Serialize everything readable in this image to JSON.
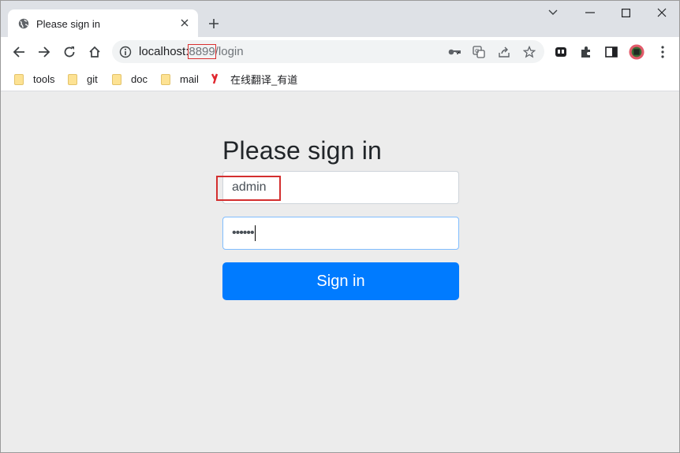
{
  "browser": {
    "tab": {
      "title": "Please sign in",
      "close_icon": "close-icon"
    },
    "new_tab_label": "+",
    "url": {
      "host": "localhost:",
      "port": "8899",
      "path": "/login"
    },
    "bookmarks": [
      {
        "label": "tools",
        "icon": "folder-icon"
      },
      {
        "label": "git",
        "icon": "folder-icon"
      },
      {
        "label": "doc",
        "icon": "folder-icon"
      },
      {
        "label": "mail",
        "icon": "folder-icon"
      },
      {
        "label": "在线翻译_有道",
        "icon": "youdao-icon"
      }
    ],
    "colors": {
      "tabstrip": "#dee1e6",
      "highlight": "#d32f2f"
    }
  },
  "page": {
    "heading": "Please sign in",
    "username": {
      "value": "admin"
    },
    "password": {
      "value": "••••••"
    },
    "signin_label": "Sign in",
    "colors": {
      "primary": "#007bff",
      "background": "#ececec"
    }
  }
}
